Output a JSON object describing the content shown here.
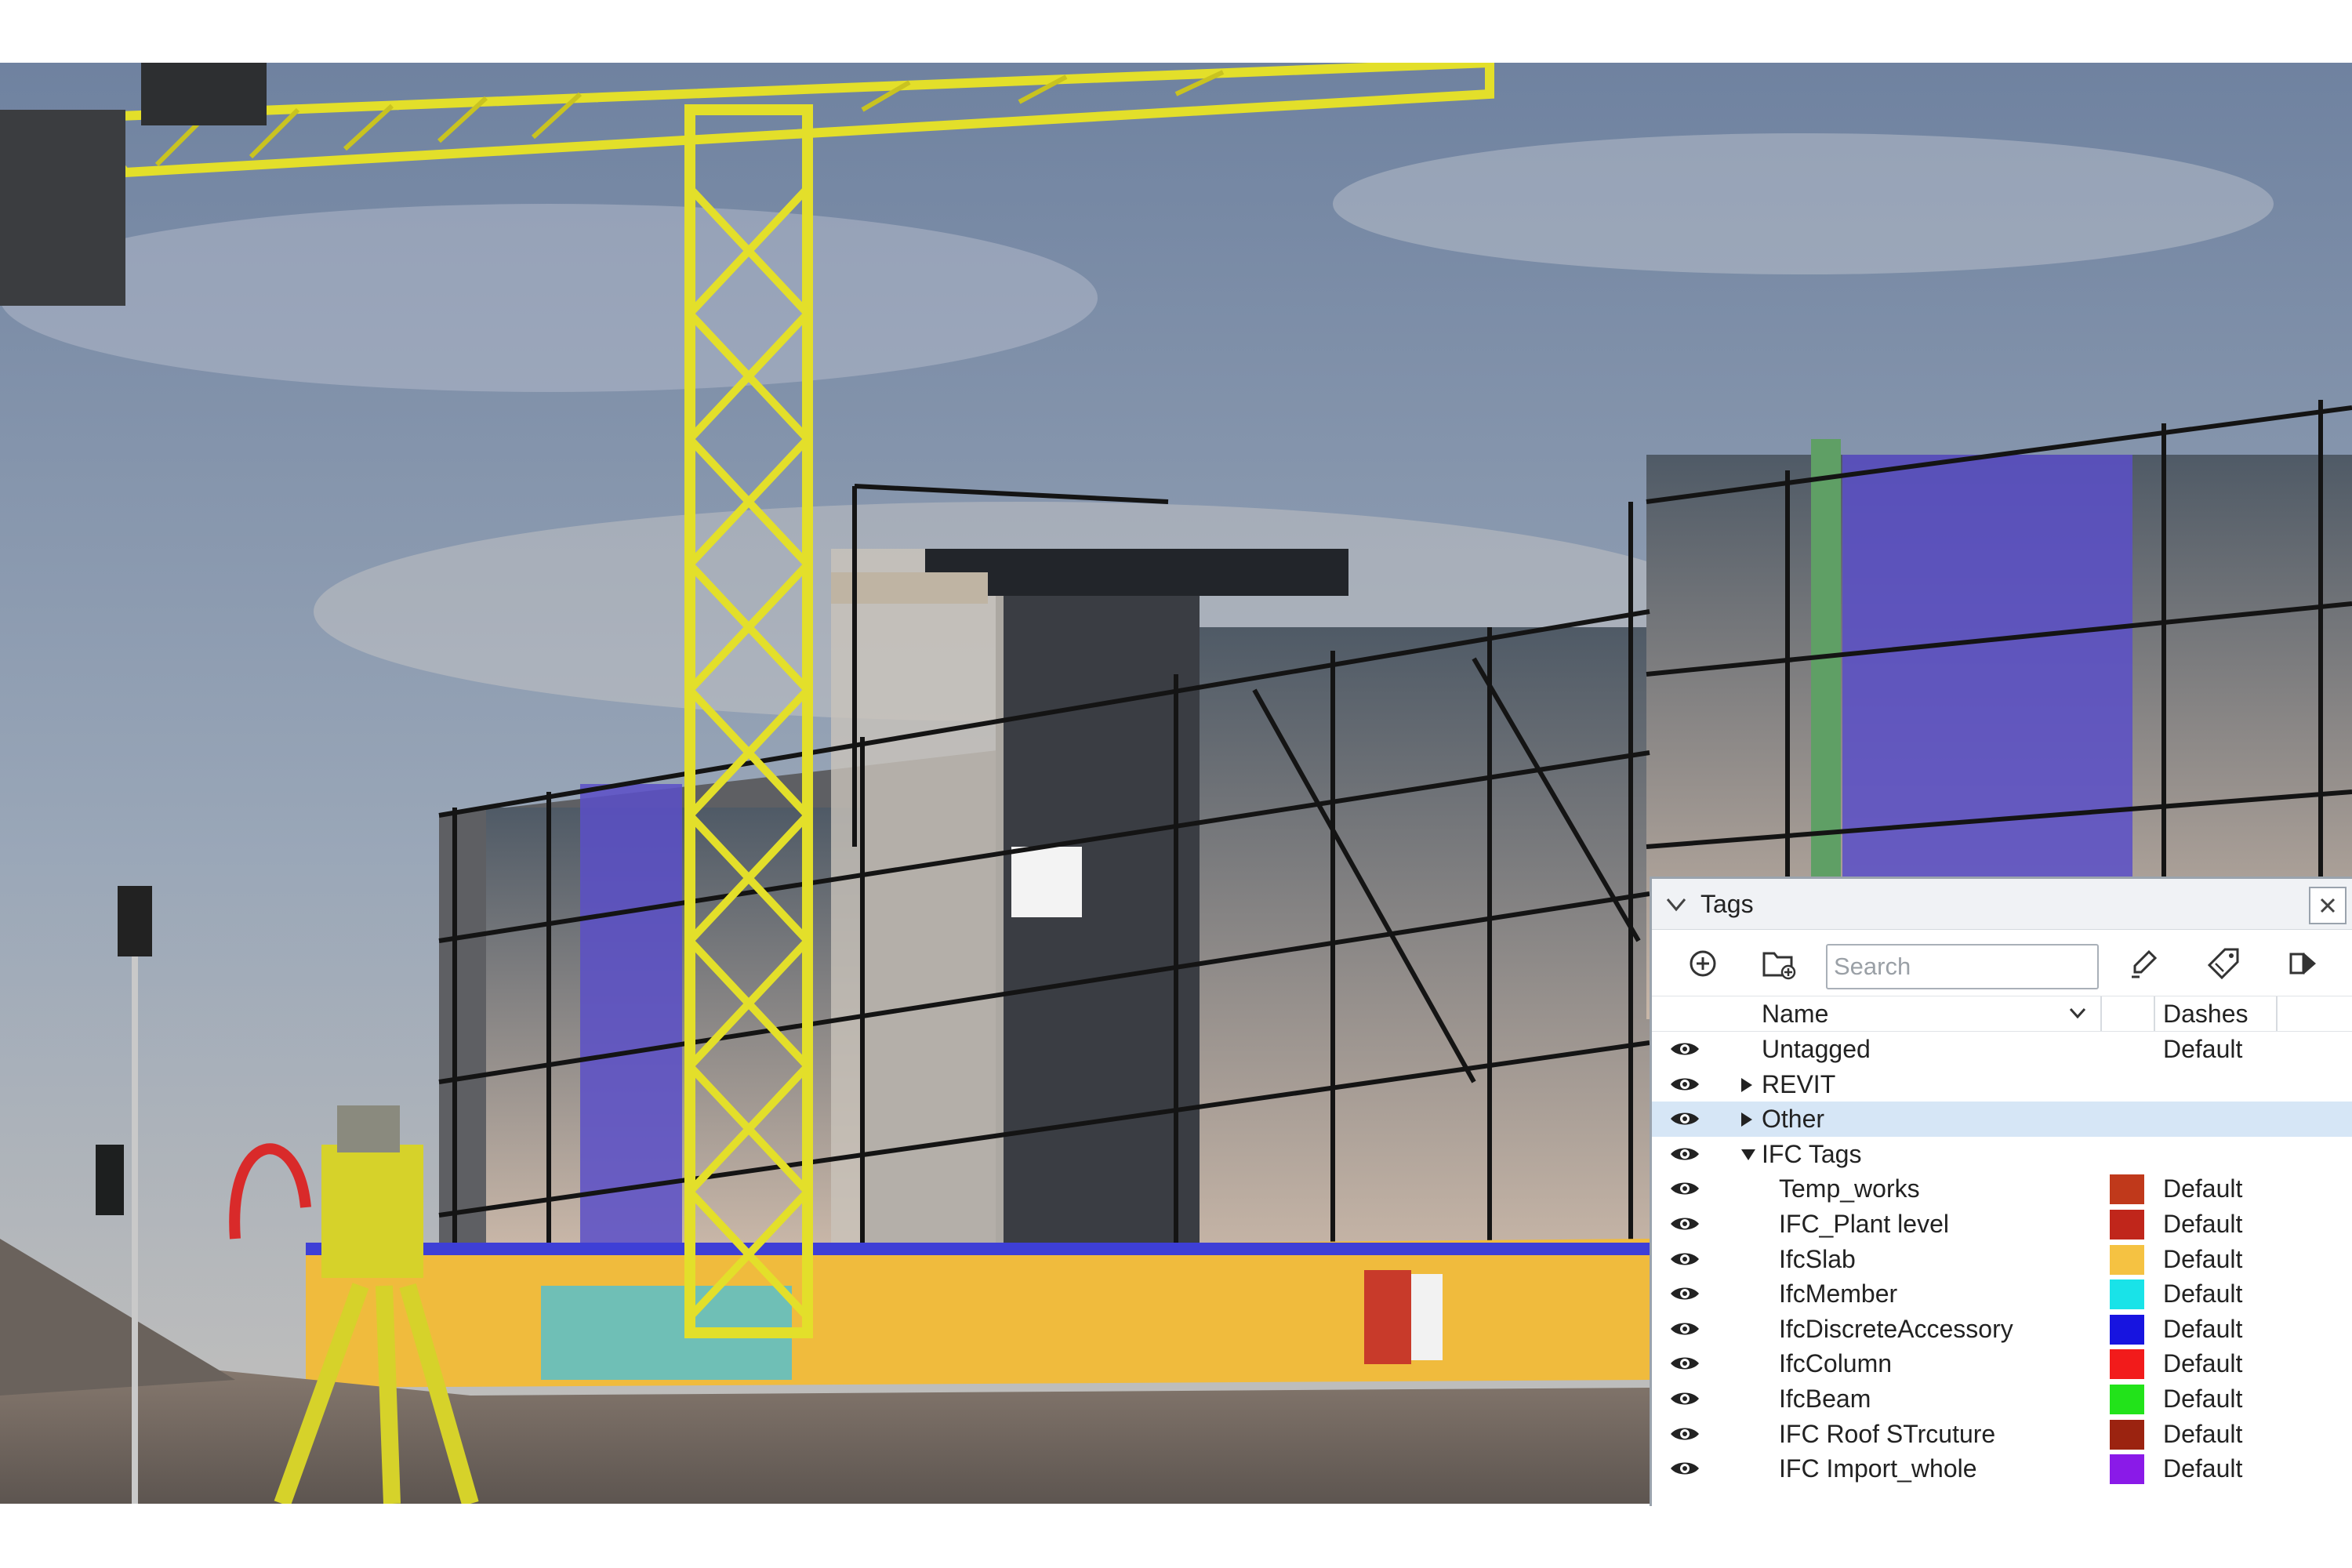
{
  "panel": {
    "title": "Tags",
    "search_placeholder": "Search",
    "columns": {
      "name": "Name",
      "dashes": "Dashes"
    },
    "rows": [
      {
        "name": "Untagged",
        "level": 0,
        "expander": "none",
        "color": "",
        "dashes": "Default",
        "selected": false
      },
      {
        "name": "REVIT",
        "level": 0,
        "expander": "collapsed",
        "color": "",
        "dashes": "",
        "selected": false
      },
      {
        "name": "Other",
        "level": 0,
        "expander": "collapsed",
        "color": "",
        "dashes": "",
        "selected": true
      },
      {
        "name": "IFC Tags",
        "level": 0,
        "expander": "expanded",
        "color": "",
        "dashes": "",
        "selected": false
      },
      {
        "name": "Temp_works",
        "level": 1,
        "expander": "none",
        "color": "#c0391b",
        "dashes": "Default",
        "selected": false
      },
      {
        "name": "IFC_Plant level",
        "level": 1,
        "expander": "none",
        "color": "#c0261b",
        "dashes": "Default",
        "selected": false
      },
      {
        "name": "IfcSlab",
        "level": 1,
        "expander": "none",
        "color": "#f5c242",
        "dashes": "Default",
        "selected": false
      },
      {
        "name": "IfcMember",
        "level": 1,
        "expander": "none",
        "color": "#19e3e8",
        "dashes": "Default",
        "selected": false
      },
      {
        "name": "IfcDiscreteAccessory",
        "level": 1,
        "expander": "none",
        "color": "#1714e0",
        "dashes": "Default",
        "selected": false
      },
      {
        "name": "IfcColumn",
        "level": 1,
        "expander": "none",
        "color": "#f21b1b",
        "dashes": "Default",
        "selected": false
      },
      {
        "name": "IfcBeam",
        "level": 1,
        "expander": "none",
        "color": "#22e31a",
        "dashes": "Default",
        "selected": false
      },
      {
        "name": "IFC Roof STrcuture",
        "level": 1,
        "expander": "none",
        "color": "#9b2310",
        "dashes": "Default",
        "selected": false
      },
      {
        "name": "IFC Import_whole",
        "level": 1,
        "expander": "none",
        "color": "#8a1ae8",
        "dashes": "Default",
        "selected": false
      }
    ]
  },
  "icons": {
    "header_chevron": "chevron-down-icon",
    "close": "close-icon",
    "toolbar": [
      "add-tag-icon",
      "add-folder-icon",
      "paint-tag-icon",
      "tag-tool-icon",
      "export-icon"
    ],
    "visibility": "eye-icon"
  },
  "colors": {
    "selection": "#d6e6f6",
    "panel_header": "#f0f2f5"
  }
}
